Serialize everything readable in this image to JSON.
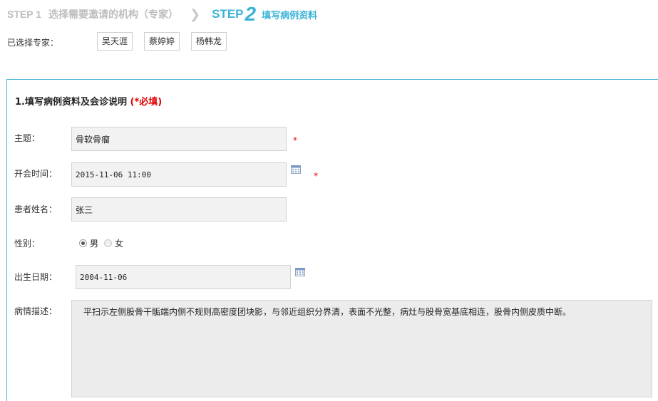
{
  "steps": {
    "step1_label": "STEP 1",
    "step1_text": "选择需要邀请的机构（专家）",
    "arrow": "❯",
    "step2_label": "STEP",
    "step2_number": "2",
    "step2_text": "填写病例资料"
  },
  "experts": {
    "label": "已选择专家：",
    "names": [
      "吴天涯",
      "蔡婷婷",
      "杨韩龙"
    ]
  },
  "form": {
    "section_title": "1.填写病例资料及会诊说明",
    "section_required": "(*必填)",
    "required_mark": "*",
    "subject_label": "主题：",
    "subject_value": "骨软骨瘤",
    "meeting_time_label": "开会时间：",
    "meeting_time_value": "2015-11-06 11:00",
    "patient_name_label": "患者姓名：",
    "patient_name_value": "张三",
    "gender_label": "性别：",
    "gender_options": [
      "男",
      "女"
    ],
    "gender_selected": "男",
    "birth_date_label": "出生日期：",
    "birth_date_value": "2004-11-06",
    "description_label": "病情描述：",
    "description_value": "平扫示左侧股骨干骺端内侧不规则高密度团块影，与邻近组织分界清，表面不光整，病灶与股骨宽基底相连，股骨内侧皮质中断。"
  },
  "icons": {
    "calendar": "calendar-icon"
  },
  "colors": {
    "accent": "#3bb3d8",
    "required": "#e00000",
    "inactive_step": "#bdbdbd"
  }
}
